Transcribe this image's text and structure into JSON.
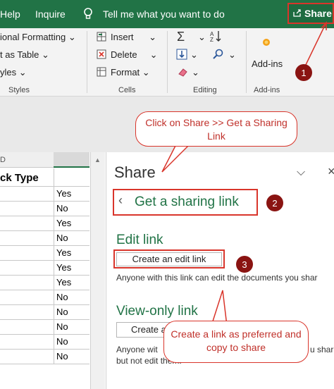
{
  "titlebar": {
    "help": "Help",
    "inquire": "Inquire",
    "tell_me": "Tell me what you want to do",
    "share": "Share"
  },
  "ribbon": {
    "styles": {
      "conditional": "ional Formatting",
      "format_table": "t as Table",
      "cell_styles": "yles",
      "label": "Styles"
    },
    "cells": {
      "insert": "Insert",
      "delete": "Delete",
      "format": "Format",
      "label": "Cells"
    },
    "editing": {
      "label": "Editing"
    },
    "addins": {
      "button": "Add-ins",
      "label": "Add-ins"
    }
  },
  "sheet": {
    "col_d": "D",
    "header": "ck Type",
    "rows": [
      "Yes",
      "No",
      "Yes",
      "No",
      "Yes",
      "Yes",
      "Yes",
      "No",
      "No",
      "No",
      "No",
      "No"
    ]
  },
  "pane": {
    "title": "Share",
    "back": "Get a sharing link",
    "edit_heading": "Edit link",
    "edit_button": "Create an edit link",
    "edit_desc": "Anyone with this link can edit the documents you shar",
    "view_heading": "View-only link",
    "view_button": "Create a",
    "view_desc_1": "Anyone wit",
    "view_desc_1b": "u shar",
    "view_desc_2": "but not edit them."
  },
  "callouts": {
    "c1": "Click on Share >> Get a Sharing Link",
    "c2": "Create a link as preferred and copy to share",
    "b1": "1",
    "b2": "2",
    "b3": "3"
  },
  "colors": {
    "excel_green": "#217346",
    "annotation_red": "#d9352b",
    "badge": "#8a1412"
  }
}
